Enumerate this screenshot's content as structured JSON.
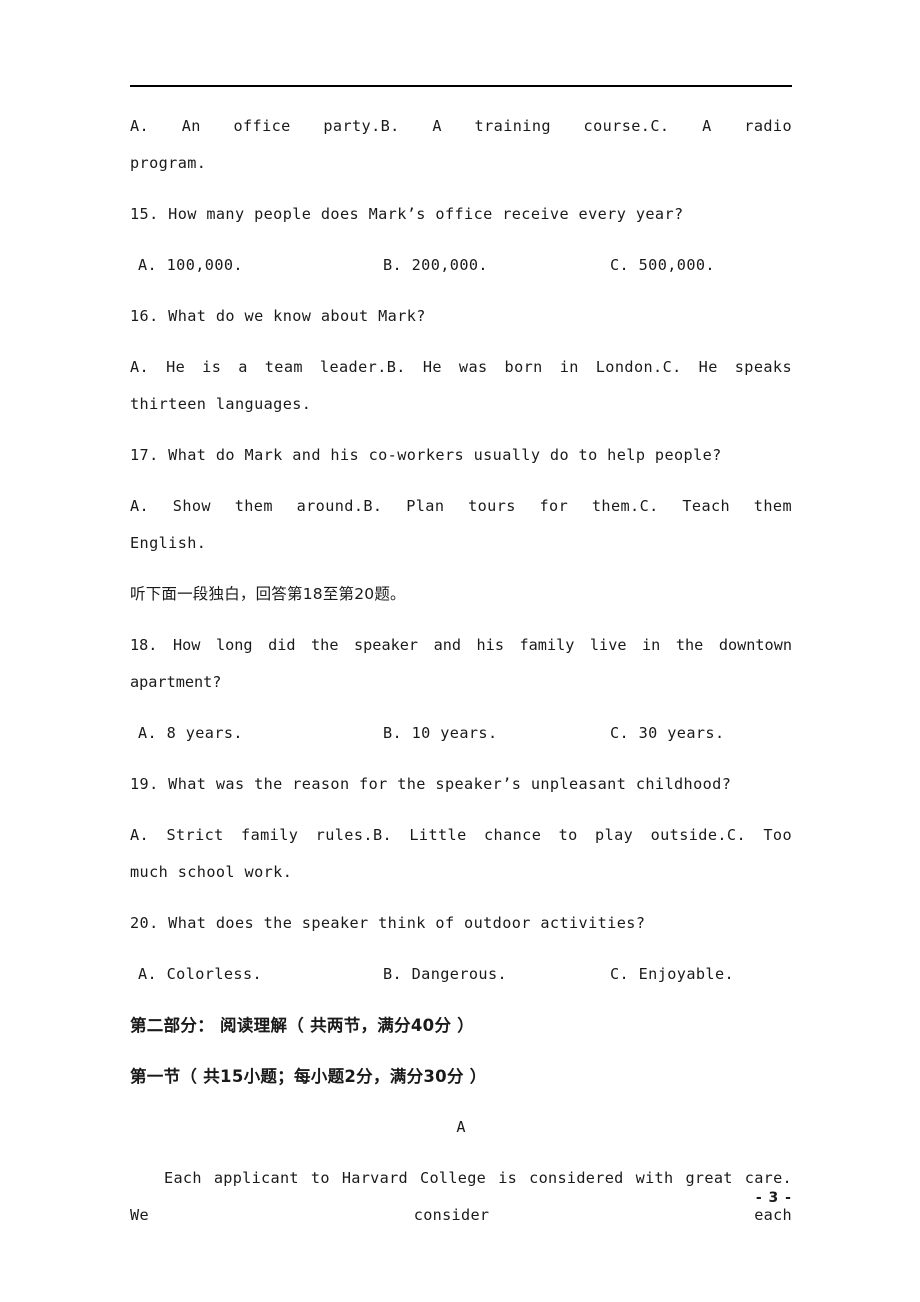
{
  "document": {
    "type": "exam-paper",
    "language_mix": "English with Chinese section headings",
    "page_number": "- 3 -",
    "header_rule": true
  },
  "listening_section": {
    "question_14_options_continued": {
      "option_a": "A. An office party.",
      "option_b": "B. A training course.",
      "option_c_part1": "C.  A  radio",
      "option_c_part2": "program."
    },
    "questions": [
      {
        "number": "15.",
        "stem": "15. How many people does Mark’s office receive every year?",
        "option_a": "A. 100,000.",
        "option_b": "B. 200,000.",
        "option_c": "C. 500,000.",
        "wraps": false
      },
      {
        "number": "16.",
        "stem": "16. What do we know about Mark?",
        "option_a": "A. He is a team leader.",
        "option_b": "B. He was born in London.",
        "option_c": "C.  He  speaks",
        "option_c_wrap": "thirteen languages.",
        "wraps": true
      },
      {
        "number": "17.",
        "stem": "17. What do Mark and his co-workers usually do to help people?",
        "option_a": "A. Show them around.",
        "option_b": "B. Plan tours for them.",
        "option_c": "C.   Teach   them",
        "option_c_wrap": "English.",
        "wraps": true
      },
      {
        "number": "18.",
        "stem": "18. How long did the speaker and his family live in the downtown apartment?",
        "option_a": "A. 8 years.",
        "option_b": "B. 10 years.",
        "option_c": "C. 30 years.",
        "wraps": false
      },
      {
        "number": "19.",
        "stem": "19. What was the reason for the speaker’s unpleasant childhood?",
        "option_a": "A. Strict family rules.",
        "option_b": "B. Little chance to play outside.",
        "option_c": "C.   Too",
        "option_c_wrap": "much school work.",
        "wraps": true
      },
      {
        "number": "20.",
        "stem": "20. What does the speaker think of outdoor activities?",
        "option_a": "A. Colorless.",
        "option_b": "B. Dangerous.",
        "option_c": "C. Enjoyable.",
        "wraps": false
      }
    ],
    "monologue_instruction": "听下面一段独白，回答第18至第20题。"
  },
  "reading_section": {
    "part_heading": "第二部分： 阅读理解（ 共两节，满分40分 ）",
    "subsection_heading": "第一节（ 共15小题；每小题2分，满分30分 ）",
    "passage_label": "A",
    "passage_text": "Each applicant to Harvard College is considered with great care. We consider each"
  },
  "colors": {
    "text": "#1a1a1a",
    "rule": "#000000",
    "background": "#ffffff"
  }
}
